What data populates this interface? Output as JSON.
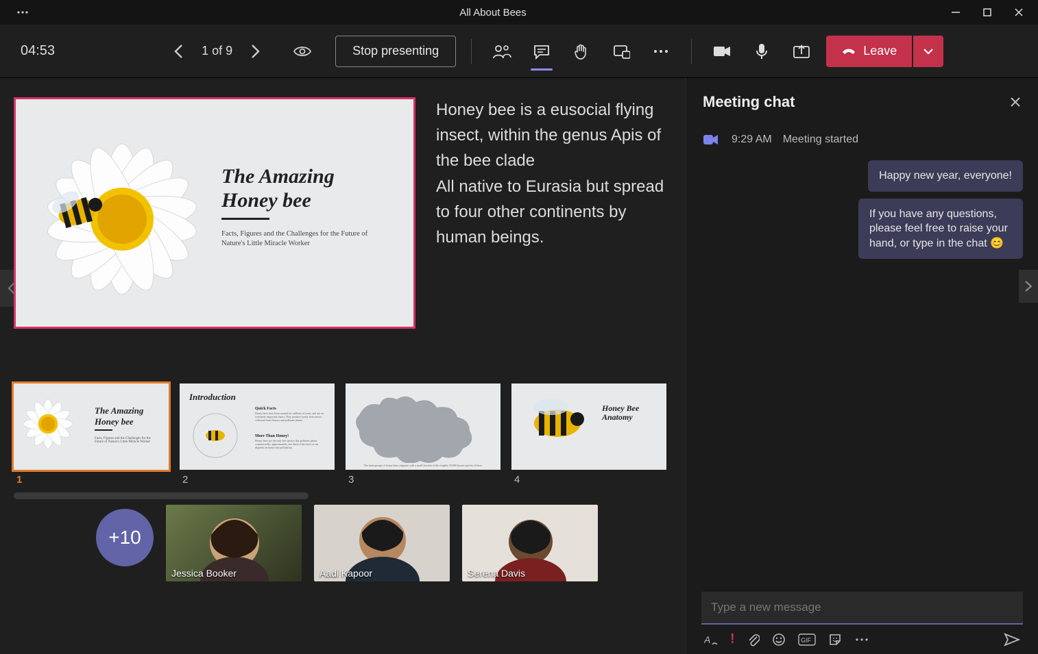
{
  "window": {
    "title": "All About Bees"
  },
  "toolbar": {
    "timer": "04:53",
    "slide_counter": "1 of 9",
    "stop_label": "Stop presenting",
    "leave_label": "Leave"
  },
  "slide": {
    "title_line1": "The Amazing",
    "title_line2": "Honey bee",
    "subtitle": "Facts, Figures and the Challenges for the Future of Nature's Little Miracle Worker"
  },
  "notes": {
    "p1": "Honey bee is a eusocial flying insect, within the genus Apis of the bee clade",
    "p2": "All native to Eurasia but spread to four other continents by human beings."
  },
  "thumbs": [
    {
      "num": "1",
      "title1": "The Amazing",
      "title2": "Honey bee",
      "selected": true
    },
    {
      "num": "2",
      "title": "Introduction",
      "sub1": "Quick Facts",
      "sub2": "More Than Honey!"
    },
    {
      "num": "3",
      "title": ""
    },
    {
      "num": "4",
      "title": "Honey Bee Anatomy"
    }
  ],
  "gallery": {
    "overflow": "+10",
    "tiles": [
      {
        "name": "Jessica Booker"
      },
      {
        "name": "Aadi Kapoor"
      },
      {
        "name": "Serena Davis"
      }
    ]
  },
  "chat": {
    "title": "Meeting chat",
    "system_time": "9:29 AM",
    "system_label": "Meeting started",
    "messages": [
      {
        "text": "Happy new year, everyone!"
      },
      {
        "text": "If you have any questions, please feel free to raise your hand, or type in the chat 😊"
      }
    ],
    "placeholder": "Type a new message"
  }
}
